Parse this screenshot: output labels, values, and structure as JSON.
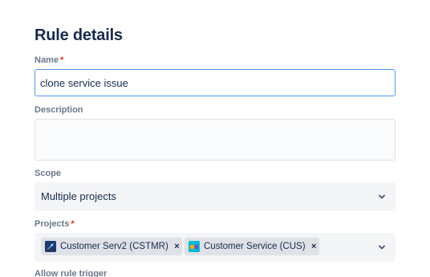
{
  "form": {
    "title": "Rule details",
    "name": {
      "label": "Name",
      "required_marker": "*",
      "value": "clone service issue"
    },
    "description": {
      "label": "Description",
      "value": ""
    },
    "scope": {
      "label": "Scope",
      "value": "Multiple projects",
      "icon": "chevron-down-icon"
    },
    "projects": {
      "label": "Projects",
      "required_marker": "*",
      "icon": "chevron-down-icon",
      "selected": [
        {
          "label": "Customer Serv2 (CSTMR)",
          "remove": "×",
          "icon": "rocket-project-icon"
        },
        {
          "label": "Customer Service (CUS)",
          "remove": "×",
          "icon": "people-project-icon"
        }
      ]
    },
    "allow_trigger": {
      "label": "Allow rule trigger"
    }
  },
  "colors": {
    "title": "#172b4d",
    "label": "#6b778c",
    "required": "#de350b",
    "focus_border": "#4c9aff",
    "select_bg": "#f4f5f7",
    "tag_bg": "#dfe1e6"
  }
}
